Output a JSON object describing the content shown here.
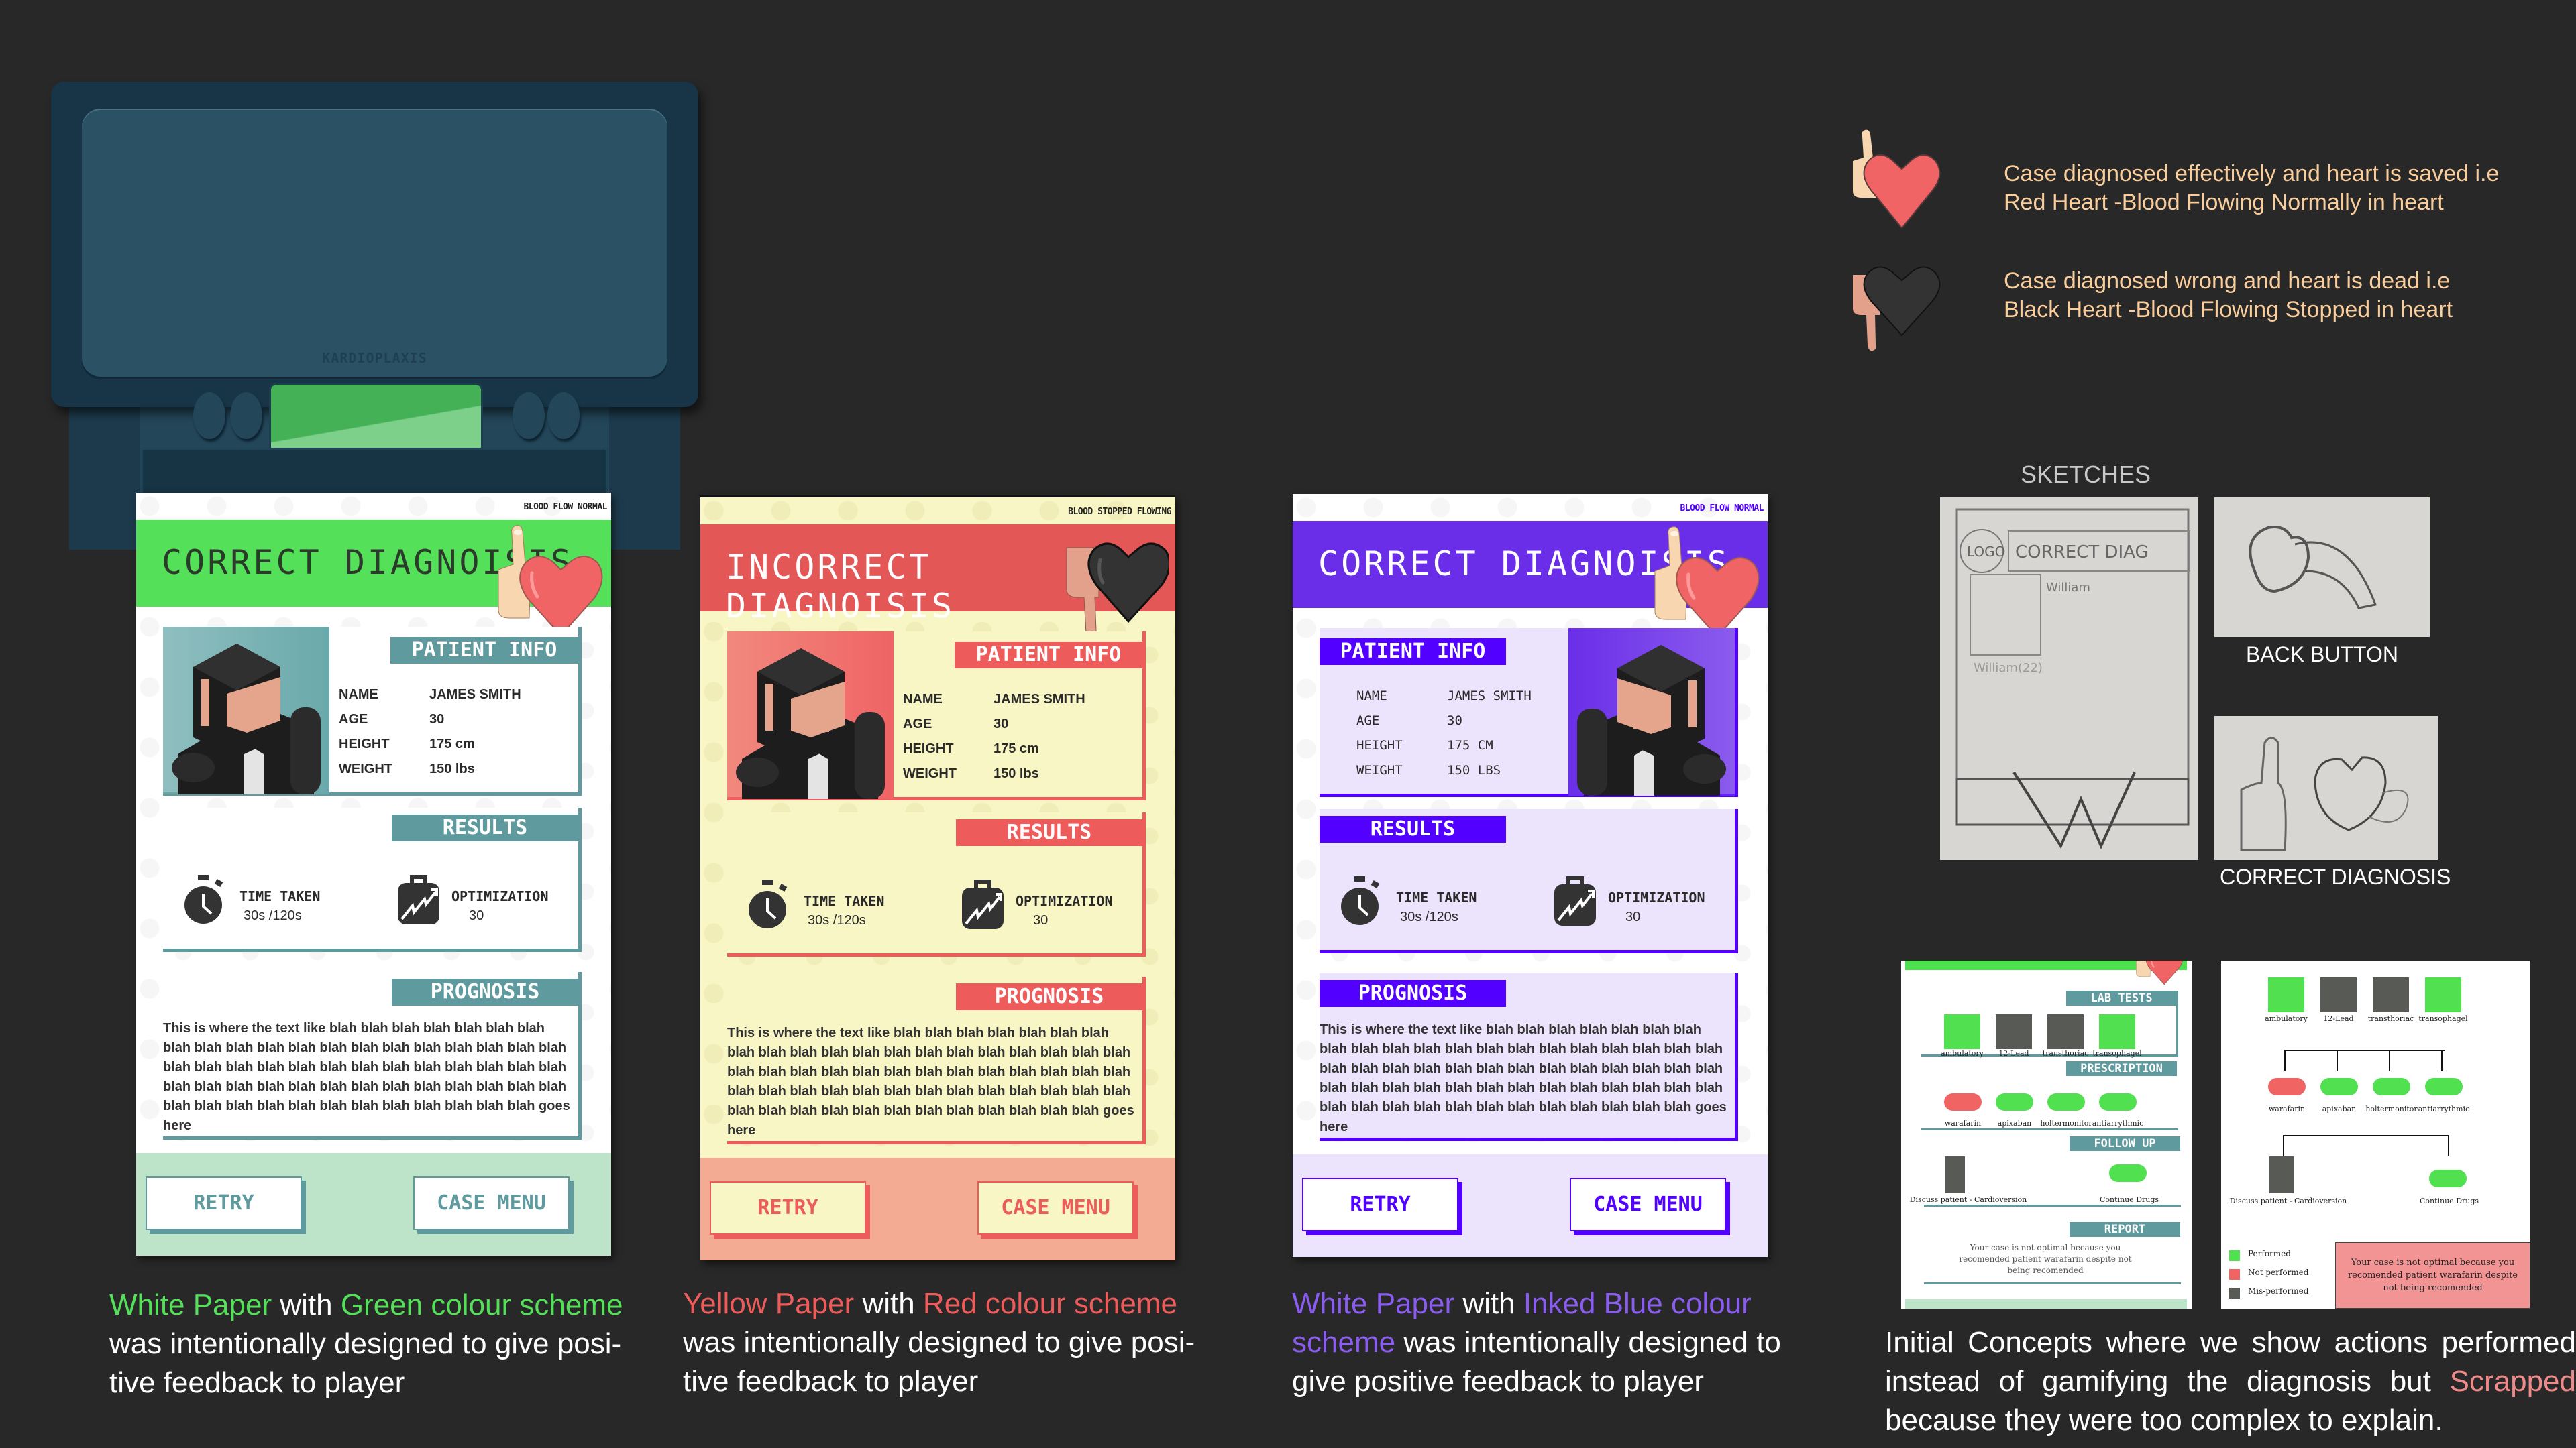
{
  "printer": {
    "brand": "KARDIOPLAXIS",
    "display_color": "#45b157"
  },
  "cards": [
    {
      "id": "green",
      "status": "BLOOD FLOW NORMAL",
      "title": "CORRECT DIAGNOISIS",
      "feedback_icon": "thumbs-up-red-heart",
      "colors": {
        "paper": "#ffffff",
        "accent": "#5f9a9e",
        "header": "#55e05a",
        "title_text": "#2b3a2b",
        "footer": "#bde4c9",
        "button_bg": "#ffffff",
        "button_text": "#5f9a9e",
        "avatar_bg": "#6aa9ab",
        "pattern": "#efefef",
        "status_text": "#222222"
      },
      "patient_info": {
        "heading": "PATIENT INFO",
        "rows": [
          {
            "label": "NAME",
            "value": "JAMES SMITH"
          },
          {
            "label": "AGE",
            "value": "30"
          },
          {
            "label": "HEIGHT",
            "value": "175 cm"
          },
          {
            "label": "WEIGHT",
            "value": "150 lbs"
          }
        ]
      },
      "results": {
        "heading": "RESULTS",
        "time_label": "TIME TAKEN",
        "time_value": "30s /120s",
        "optimization_label": "OPTIMIZATION",
        "optimization_value": "30"
      },
      "prognosis": {
        "heading": "PROGNOSIS",
        "text": "This is where the text like blah blah blah blah blah blah blah blah blah blah blah blah blah blah blah blah blah blah blah blah blah blah blah blah blah blah blah blah blah blah blah blah blah blah blah blah blah blah blah blah blah blah blah blah blah blah blah blah blah blah blah blah blah blah blah blah blah blah goes here"
      },
      "buttons": {
        "retry": "RETRY",
        "case_menu": "CASE MENU"
      }
    },
    {
      "id": "red",
      "status": "BLOOD STOPPED FLOWING",
      "title": "INCORRECT DIAGNOISIS",
      "feedback_icon": "thumbs-down-black-heart",
      "colors": {
        "paper": "#f9f6c5",
        "accent": "#ee5b5b",
        "header": "#e35757",
        "title_text": "#ffffff",
        "footer": "#f4ab93",
        "button_bg": "#f9f6c5",
        "button_text": "#ee5b5b",
        "avatar_bg": "#ef6466",
        "pattern": "#ebe7b0",
        "status_text": "#222222"
      },
      "patient_info": {
        "heading": "PATIENT INFO",
        "rows": [
          {
            "label": "NAME",
            "value": "JAMES SMITH"
          },
          {
            "label": "AGE",
            "value": "30"
          },
          {
            "label": "HEIGHT",
            "value": "175 cm"
          },
          {
            "label": "WEIGHT",
            "value": "150 lbs"
          }
        ]
      },
      "results": {
        "heading": "RESULTS",
        "time_label": "TIME TAKEN",
        "time_value": "30s /120s",
        "optimization_label": "OPTIMIZATION",
        "optimization_value": "30"
      },
      "prognosis": {
        "heading": "PROGNOSIS",
        "text": "This is where the text like blah blah blah blah blah blah blah blah blah blah blah blah blah blah blah blah blah blah blah blah blah blah blah blah blah blah blah blah blah blah blah blah blah blah blah blah blah blah blah blah blah blah blah blah blah blah blah blah blah blah blah blah blah blah blah blah blah blah goes here"
      },
      "buttons": {
        "retry": "RETRY",
        "case_menu": "CASE MENU"
      }
    },
    {
      "id": "blue",
      "status": "BLOOD FLOW NORMAL",
      "title": "CORRECT DIAGNOISIS",
      "feedback_icon": "thumbs-up-red-heart",
      "colors": {
        "paper": "#ffffff",
        "accent": "#5200ff",
        "header": "#6a2ee8",
        "title_text": "#ffffff",
        "footer": "#ece4fc",
        "button_bg": "#ffffff",
        "button_text": "#5200ff",
        "avatar_bg": "#6a2ee8",
        "pattern": "#efefef",
        "status_text": "#5200ff",
        "panel_bg": "#ece4fc"
      },
      "patient_info": {
        "heading": "PATIENT INFO",
        "rows": [
          {
            "label": "NAME",
            "value": "JAMES SMITH"
          },
          {
            "label": "AGE",
            "value": "30"
          },
          {
            "label": "HEIGHT",
            "value": "175 CM"
          },
          {
            "label": "WEIGHT",
            "value": "150 LBS"
          }
        ]
      },
      "results": {
        "heading": "RESULTS",
        "time_label": "TIME TAKEN",
        "time_value": "30s /120s",
        "optimization_label": "OPTIMIZATION",
        "optimization_value": "30"
      },
      "prognosis": {
        "heading": "PROGNOSIS",
        "text": "This is where the text like blah blah blah blah blah blah blah blah blah blah blah blah blah blah blah blah blah blah blah blah blah blah blah blah blah blah blah blah blah blah blah blah blah blah blah blah blah blah blah blah blah blah blah blah blah blah blah blah blah blah blah blah blah blah blah blah blah blah goes here"
      },
      "buttons": {
        "retry": "RETRY",
        "case_menu": "CASE MENU"
      }
    }
  ],
  "captions": [
    {
      "parts": [
        {
          "text": "White Paper",
          "color": "#55e05a"
        },
        {
          "text": " with ",
          "color": "#ffffff"
        },
        {
          "text": "Green colour scheme",
          "color": "#55e05a"
        },
        {
          "text": " was intentionally designed to give posi-tive feedback to player",
          "color": "#ffffff"
        }
      ]
    },
    {
      "parts": [
        {
          "text": "Yellow Paper",
          "color": "#ee5b5b"
        },
        {
          "text": " with ",
          "color": "#ffffff"
        },
        {
          "text": "Red colour scheme",
          "color": "#ee5b5b"
        },
        {
          "text": " was intentionally designed to give posi-tive feedback to player",
          "color": "#ffffff"
        }
      ]
    },
    {
      "parts": [
        {
          "text": "White Paper",
          "color": "#8a5cf0"
        },
        {
          "text": " with ",
          "color": "#ffffff"
        },
        {
          "text": "Inked Blue colour scheme",
          "color": "#8a5cf0"
        },
        {
          "text": " was intentionally designed to give positive feedback to player",
          "color": "#ffffff"
        }
      ]
    },
    {
      "parts": [
        {
          "text": "Initial Concepts where we show actions performed instead of gamifying the diagnosis but ",
          "color": "#ffffff"
        },
        {
          "text": "Scrapped",
          "color": "#f08a8a"
        },
        {
          "text": " because they were too complex to explain.",
          "color": "#ffffff"
        }
      ]
    }
  ],
  "legend": {
    "items": [
      {
        "icon": "thumbs-up-red-heart",
        "line1": "Case diagnosed effectively and heart is saved  i.e",
        "line2": "Red Heart -Blood Flowing Normally in heart"
      },
      {
        "icon": "thumbs-down-black-heart",
        "line1": "Case diagnosed wrong and heart is dead  i.e",
        "line2": "Black Heart -Blood Flowing Stopped in heart"
      }
    ]
  },
  "sketches": {
    "title": "SKETCHES",
    "main_sketch_text": {
      "header": "CORRECT DIAG",
      "logo": "LOGO",
      "name1": "William",
      "name2": "William(22)"
    },
    "back_button_caption": "BACK BUTTON",
    "correct_diagnosis_caption": "CORRECT DIAGNOSIS"
  },
  "concepts": {
    "concept1": {
      "lab_tests_heading": "LAB TESTS",
      "prescription_heading": "PRESCRIPTION",
      "follow_up_heading": "FOLLOW UP",
      "report_heading": "REPORT"
    },
    "lab_tests": [
      {
        "label": "ambulatory",
        "state": "performed"
      },
      {
        "label": "12-Lead",
        "state": "mis-performed"
      },
      {
        "label": "transthoriac",
        "state": "mis-performed"
      },
      {
        "label": "transophagel",
        "state": "performed"
      }
    ],
    "prescriptions": [
      {
        "label": "warafarin",
        "state": "not-performed"
      },
      {
        "label": "apixaban",
        "state": "performed"
      },
      {
        "label": "holtermonitor",
        "state": "performed"
      },
      {
        "label": "antiarrythmic",
        "state": "performed"
      }
    ],
    "follow_up": [
      {
        "label": "Discuss patient - Cardioversion",
        "state": "mis-performed"
      },
      {
        "label": "Continue Drugs",
        "state": "performed"
      }
    ],
    "report_text": "Your case is not optimal because you recomended patient warafarin despite not being recomended",
    "legend": [
      {
        "label": "Performed",
        "state": "performed"
      },
      {
        "label": "Not performed",
        "state": "not-performed"
      },
      {
        "label": "Mis-performed",
        "state": "mis-performed"
      }
    ],
    "state_colors": {
      "performed": "#50e050",
      "not-performed": "#f06464",
      "mis-performed": "#575a55"
    },
    "report_box_color": "#f29494"
  }
}
